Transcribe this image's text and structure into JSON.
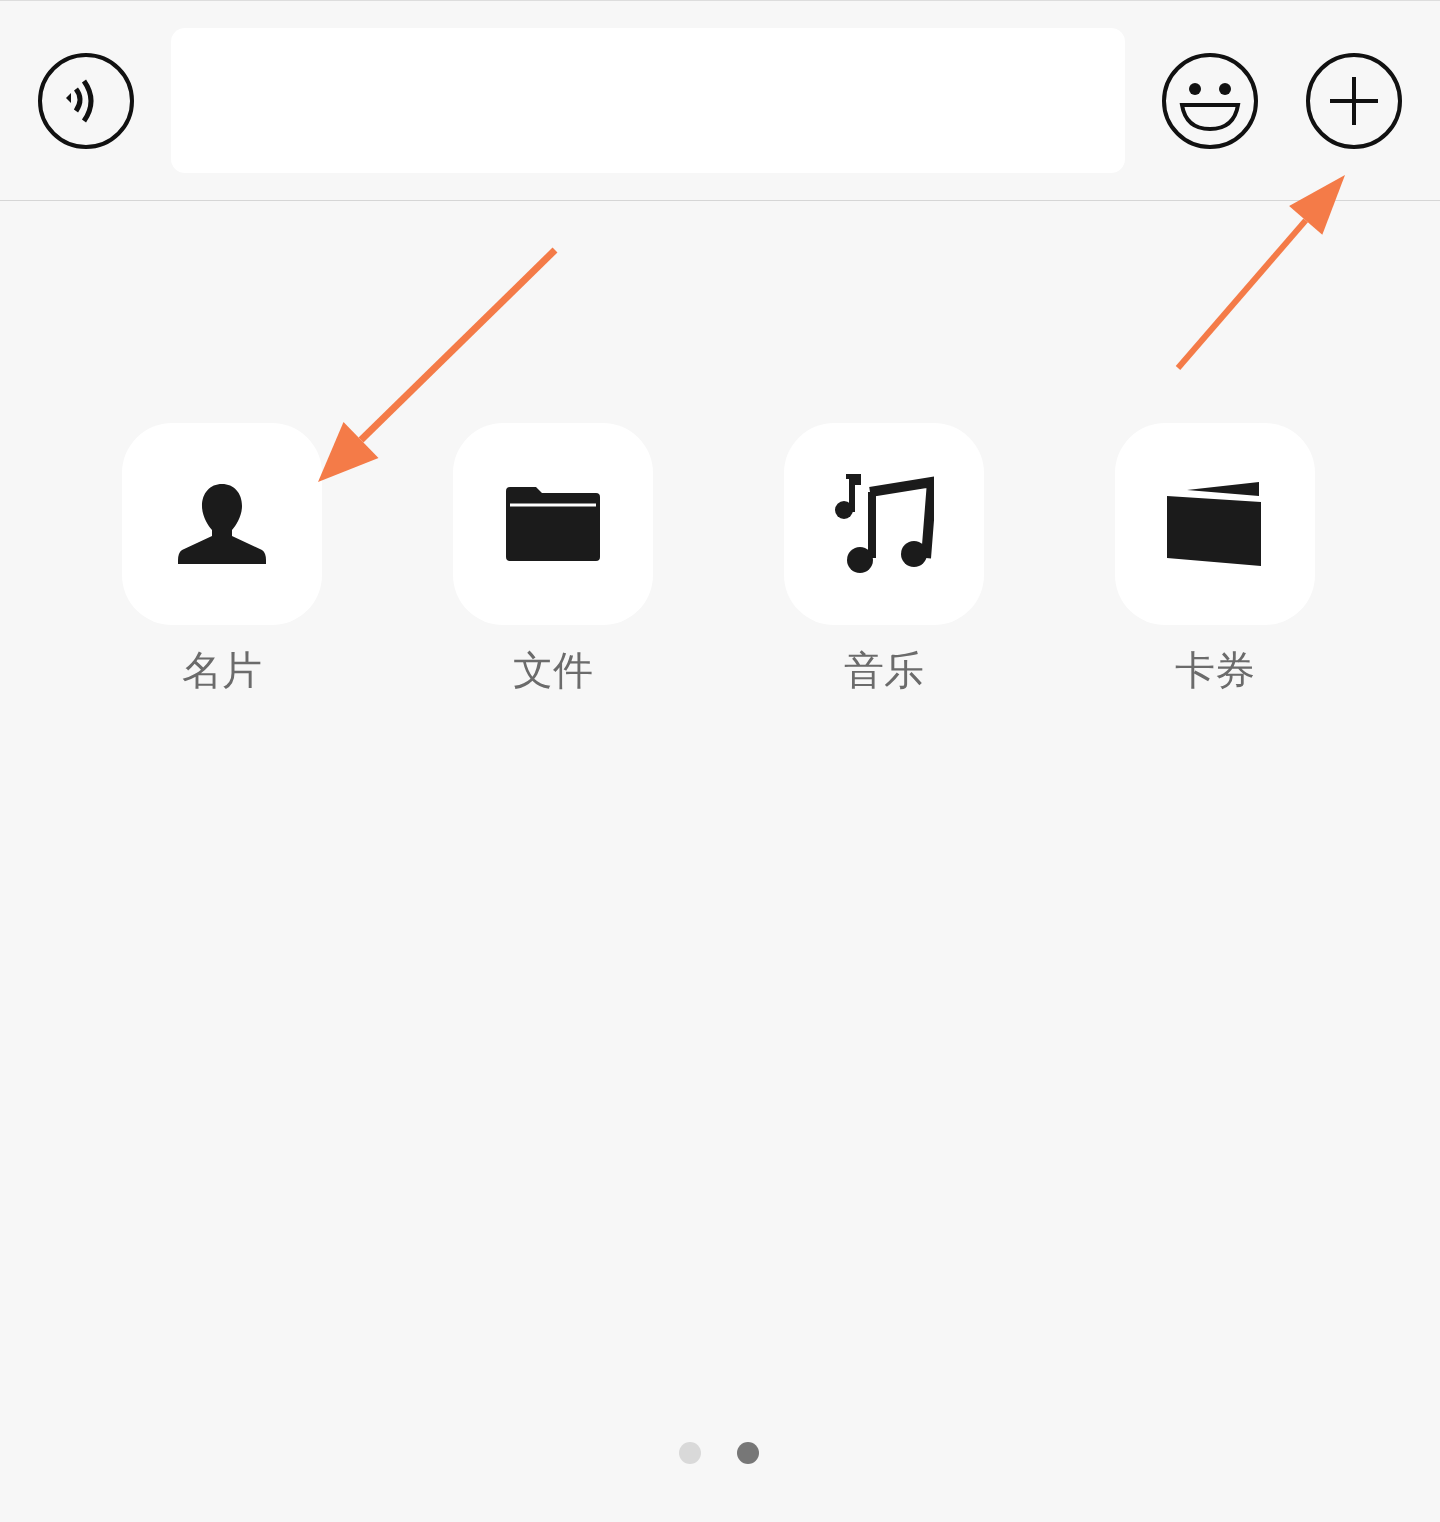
{
  "input_bar": {
    "buttons": [
      {
        "kind": "voice"
      },
      {
        "kind": "emoji"
      },
      {
        "kind": "plus"
      }
    ]
  },
  "apps": [
    {
      "label": "名片",
      "kind": "person"
    },
    {
      "label": "文件",
      "kind": "folder"
    },
    {
      "label": "音乐",
      "kind": "music"
    },
    {
      "label": "卡券",
      "kind": "card"
    }
  ],
  "pages": [
    {
      "selected": false
    },
    {
      "selected": true
    }
  ]
}
